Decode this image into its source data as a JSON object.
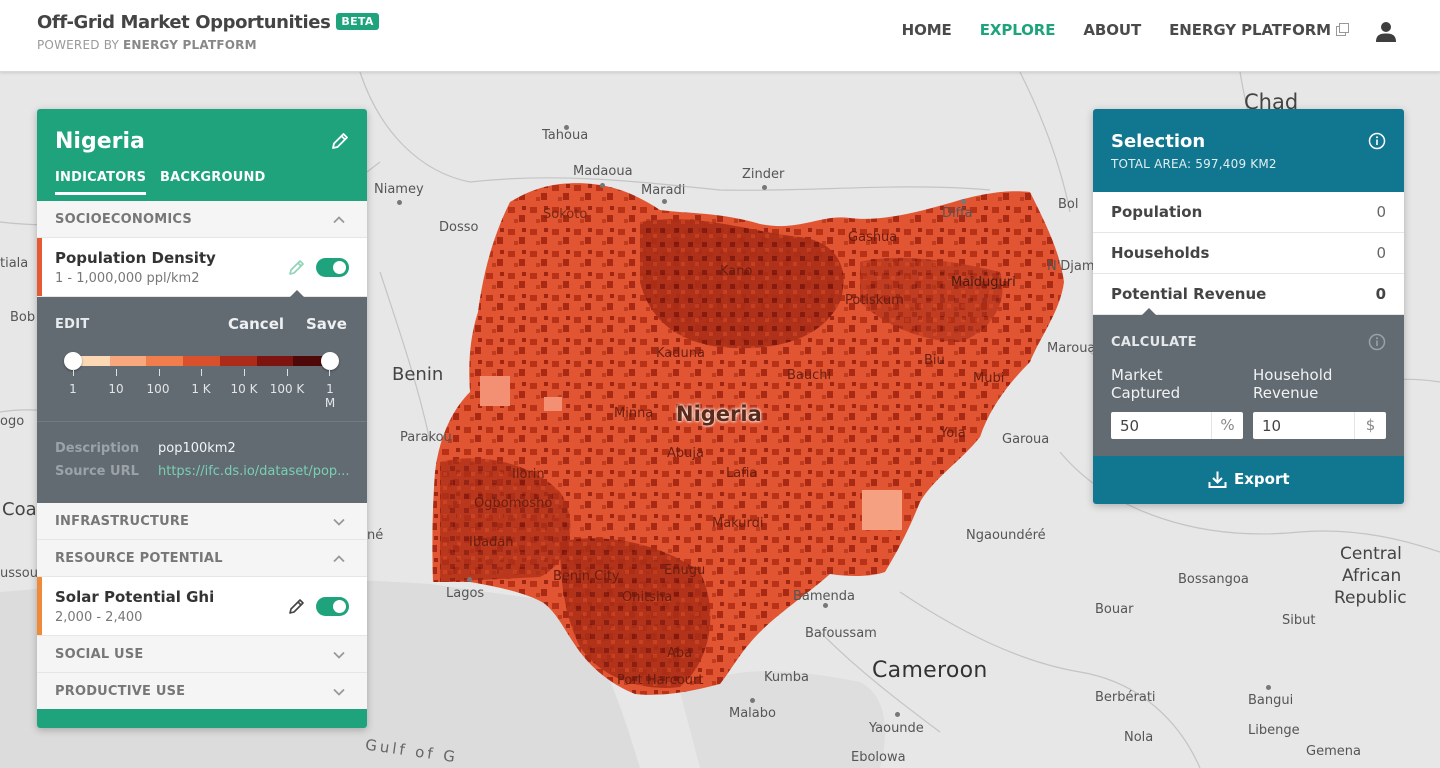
{
  "header": {
    "title": "Off-Grid Market Opportunities",
    "badge": "BETA",
    "powered_prefix": "POWERED BY",
    "powered_name": "ENERGY PLATFORM",
    "nav": [
      "HOME",
      "EXPLORE",
      "ABOUT",
      "ENERGY PLATFORM"
    ],
    "active_nav": "EXPLORE"
  },
  "map": {
    "labels": {
      "chad": "Chad",
      "tahoua": "Tahoua",
      "madaoua": "Madaoua",
      "maradi": "Maradi",
      "zinder": "Zinder",
      "niamey": "Niamey",
      "dosso": "Dosso",
      "diffa": "Diffa",
      "bol": "Bol",
      "tiala": "tiala",
      "bob": "Bob",
      "benin": "Benin",
      "ogo": "ogo",
      "parakou": "Parakou",
      "coa": "Coa",
      "ne": "né",
      "nigeria": "Nigeria",
      "maiduguri": "Maiduguri",
      "ndjam": "N'Djam",
      "maroua": "Maroua",
      "garoua": "Garoua",
      "ngaoundere": "Ngaoundéré",
      "central": "Central",
      "african": "African",
      "republic": "Republic",
      "bossangoa": "Bossangoa",
      "bouar": "Bouar",
      "sibut": "Sibut",
      "lagos": "Lagos",
      "bamenda": "Bamenda",
      "bafoussam": "Bafoussam",
      "cameroon": "Cameroon",
      "kumba": "Kumba",
      "malabo": "Malabo",
      "yaounde": "Yaounde",
      "ebolowa": "Ebolowa",
      "berberati": "Berbérati",
      "bangui": "Bangui",
      "libenge": "Libenge",
      "nola": "Nola",
      "gemena": "Gemena",
      "gulf": "Gulf of G",
      "ussou": "ussou",
      "sokoto": "Sokoto",
      "kano": "Kano",
      "kaduna": "Kaduna",
      "bauchi": "Bauchi",
      "gashua": "Gashua",
      "potiskum": "Potiskum",
      "biu": "Biu",
      "mubi": "Mubi",
      "yola": "Yola",
      "minna": "Minna",
      "abuja": "Abuja",
      "lafia": "Lafia",
      "ilorin": "Ilorin",
      "ogbomosho": "Ogbomosho",
      "ibadan": "Ibadan",
      "benin_city": "Benin City",
      "enugu": "Enugu",
      "onitsha": "Onitsha",
      "makurdi": "Makurdi",
      "aba": "Aba",
      "port_harcourt": "Port Harcourt"
    }
  },
  "left_panel": {
    "country": "Nigeria",
    "tabs": [
      "INDICATORS",
      "BACKGROUND"
    ],
    "sections": {
      "socioeconomics": "SOCIOECONOMICS",
      "infrastructure": "INFRASTRUCTURE",
      "resource_potential": "RESOURCE POTENTIAL",
      "social_use": "SOCIAL USE",
      "productive_use": "PRODUCTIVE USE"
    },
    "population_layer": {
      "name": "Population Density",
      "range": "1 - 1,000,000 ppl/km2",
      "color": "#e35a35"
    },
    "solar_layer": {
      "name": "Solar Potential Ghi",
      "range": "2,000 - 2,400",
      "color": "#f08a3b"
    },
    "edit": {
      "label": "EDIT",
      "cancel": "Cancel",
      "save": "Save",
      "ticks": [
        "1",
        "10",
        "100",
        "1 K",
        "10 K",
        "100 K",
        "1 M"
      ],
      "ramp_colors": [
        "#fcd9b4",
        "#f9a77c",
        "#f07d4c",
        "#d8512c",
        "#ac2c19",
        "#7e1410",
        "#4e0808"
      ],
      "description_label": "Description",
      "description_value": "pop100km2",
      "source_label": "Source URL",
      "source_value": "https://ifc.ds.io/dataset/pop..."
    }
  },
  "right_panel": {
    "title": "Selection",
    "subtitle": "TOTAL AREA: 597,409 KM2",
    "stats": [
      {
        "label": "Population",
        "value": "0"
      },
      {
        "label": "Households",
        "value": "0"
      },
      {
        "label": "Potential Revenue",
        "value": "0"
      }
    ],
    "calculate_label": "CALCULATE",
    "market_label_1": "Market",
    "market_label_2": "Captured",
    "revenue_label_1": "Household",
    "revenue_label_2": "Revenue",
    "market_value": "50",
    "market_unit": "%",
    "revenue_value": "10",
    "revenue_unit": "$",
    "export_label": "Export"
  }
}
